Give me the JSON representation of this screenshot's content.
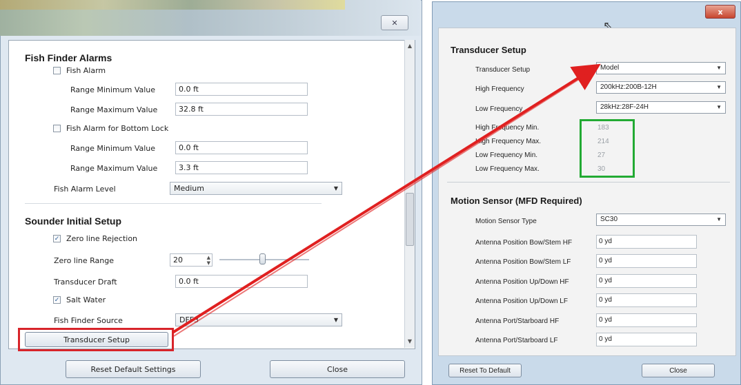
{
  "left_dialog": {
    "close_glyph": "✕",
    "fish_finder_alarms": {
      "title": "Fish Finder Alarms",
      "fish_alarm_label": "Fish Alarm",
      "range_min_label": "Range Minimum Value",
      "range_min_value": "0.0 ft",
      "range_max_label": "Range Maximum Value",
      "range_max_value": "32.8 ft",
      "bottom_lock_label": "Fish Alarm for Bottom Lock",
      "bl_range_min_label": "Range Minimum Value",
      "bl_range_min_value": "0.0 ft",
      "bl_range_max_label": "Range Maximum Value",
      "bl_range_max_value": "3.3 ft",
      "alarm_level_label": "Fish Alarm Level",
      "alarm_level_value": "Medium"
    },
    "sounder_initial_setup": {
      "title": "Sounder Initial Setup",
      "zero_line_rejection_label": "Zero line Rejection",
      "zero_line_range_label": "Zero line Range",
      "zero_line_range_value": "20",
      "transducer_draft_label": "Transducer Draft",
      "transducer_draft_value": "0.0 ft",
      "salt_water_label": "Salt Water",
      "fish_finder_source_label": "Fish Finder Source",
      "fish_finder_source_value": "DFF3",
      "transducer_setup_button": "Transducer Setup"
    },
    "footer": {
      "reset_button": "Reset Default Settings",
      "close_button": "Close"
    }
  },
  "right_dialog": {
    "close_glyph": "x",
    "transducer_setup": {
      "title": "Transducer Setup",
      "setup_label": "Transducer Setup",
      "setup_value": "Model",
      "high_freq_label": "High Frequency",
      "high_freq_value": "200kHz:200B-12H",
      "low_freq_label": "Low Frequency",
      "low_freq_value": "28kHz:28F-24H",
      "hf_min_label": "High Frequency Min.",
      "hf_min_value": "183",
      "hf_max_label": "High Frequency Max.",
      "hf_max_value": "214",
      "lf_min_label": "Low Frequency Min.",
      "lf_min_value": "27",
      "lf_max_label": "Low Frequency Max.",
      "lf_max_value": "30"
    },
    "motion_sensor": {
      "title": "Motion Sensor (MFD Required)",
      "type_label": "Motion Sensor Type",
      "type_value": "SC30",
      "bow_hf_label": "Antenna Position Bow/Stem HF",
      "bow_hf_value": "0 yd",
      "bow_lf_label": "Antenna Position Bow/Stem LF",
      "bow_lf_value": "0 yd",
      "updown_hf_label": "Antenna Position Up/Down HF",
      "updown_hf_value": "0 yd",
      "updown_lf_label": "Antenna Position Up/Down LF",
      "updown_lf_value": "0 yd",
      "port_hf_label": "Antenna Port/Starboard HF",
      "port_hf_value": "0 yd",
      "port_lf_label": "Antenna Port/Starboard LF",
      "port_lf_value": "0 yd"
    },
    "footer": {
      "reset_button": "Reset To Default",
      "close_button": "Close"
    }
  },
  "annotations": {
    "arrow_color": "#e02020",
    "highlight_red": "#d8242a",
    "highlight_green": "#22aa33"
  }
}
